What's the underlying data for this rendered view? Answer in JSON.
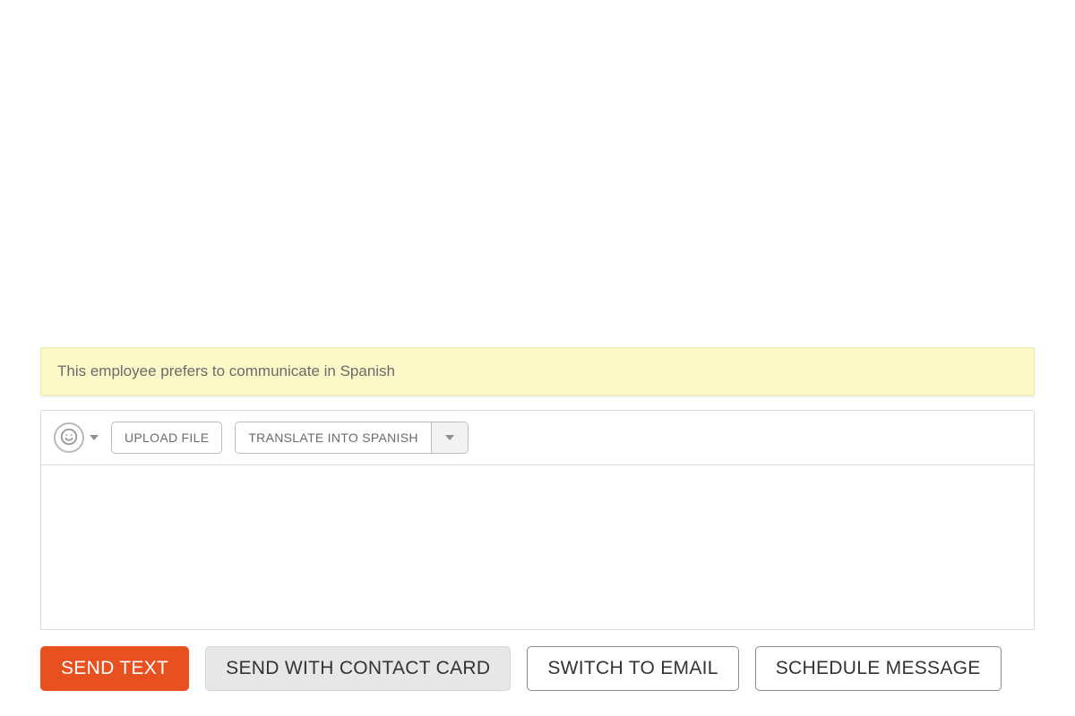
{
  "notice": {
    "text": "This employee prefers to communicate in Spanish"
  },
  "toolbar": {
    "upload_label": "UPLOAD FILE",
    "translate_label": "TRANSLATE INTO SPANISH"
  },
  "message": {
    "value": ""
  },
  "actions": {
    "send_text": "SEND TEXT",
    "send_with_contact_card": "SEND WITH CONTACT CARD",
    "switch_to_email": "SWITCH TO EMAIL",
    "schedule_message": "SCHEDULE MESSAGE"
  }
}
